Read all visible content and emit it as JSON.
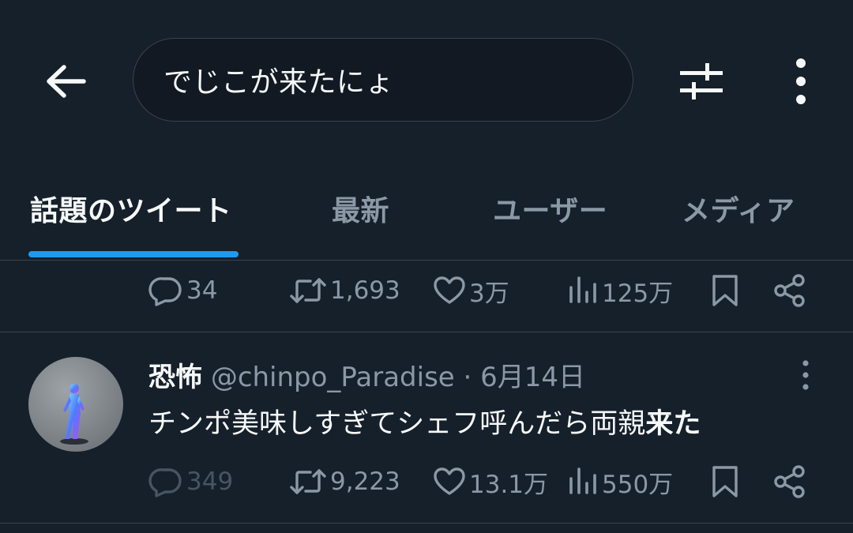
{
  "search": {
    "query": "でじこが来たにょ"
  },
  "icons": {
    "back": "arrow-left-icon",
    "filter": "sliders-icon",
    "more": "more-vertical-icon",
    "reply": "reply-icon",
    "retweet": "retweet-icon",
    "like": "heart-icon",
    "views": "views-icon",
    "bookmark": "bookmark-icon",
    "share": "share-icon"
  },
  "tabs": [
    {
      "label": "話題のツイート",
      "active": true
    },
    {
      "label": "最新",
      "active": false
    },
    {
      "label": "ユーザー",
      "active": false
    },
    {
      "label": "メディア",
      "active": false
    }
  ],
  "tweets": [
    {
      "stats": {
        "replies": "34",
        "retweets": "1,693",
        "likes": "3万",
        "views": "125万"
      }
    },
    {
      "author": {
        "name": "恐怖",
        "handle": "@chinpo_Paradise"
      },
      "separator": "·",
      "date": "6月14日",
      "text_plain": "チンポ美味しすぎてシェフ呼んだら両親",
      "text_highlight": "来た",
      "stats": {
        "replies": "349",
        "retweets": "9,223",
        "likes": "13.1万",
        "views": "550万"
      }
    }
  ],
  "colors": {
    "background": "#15202b",
    "accent": "#1d9bf0",
    "text_primary": "#f7f9f9",
    "text_secondary": "#8b98a5",
    "border": "#38444d"
  }
}
